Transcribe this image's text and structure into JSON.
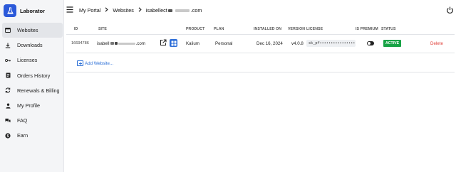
{
  "brand": {
    "name": "Laborator"
  },
  "sidebar": {
    "items": [
      {
        "label": "Websites",
        "icon": "browser-icon",
        "active": true
      },
      {
        "label": "Downloads",
        "icon": "download-icon",
        "active": false
      },
      {
        "label": "Licenses",
        "icon": "key-icon",
        "active": false
      },
      {
        "label": "Orders History",
        "icon": "receipt-icon",
        "active": false
      },
      {
        "label": "Renewals & Billing",
        "icon": "renew-icon",
        "active": false
      },
      {
        "label": "My Profile",
        "icon": "user-icon",
        "active": false
      },
      {
        "label": "FAQ",
        "icon": "chat-icon",
        "active": false
      },
      {
        "label": "Earn",
        "icon": "coin-icon",
        "active": false
      }
    ]
  },
  "breadcrumb": {
    "items": [
      "My Portal",
      "Websites",
      "isabellect"
    ],
    "last_suffix": ".com"
  },
  "table": {
    "headers": {
      "id": "ID",
      "site": "SITE",
      "product": "PRODUCT",
      "plan": "PLAN",
      "installed_on": "INSTALLED ON",
      "version": "VERSION",
      "license": "LICENSE",
      "is_premium": "IS PREMIUM",
      "status": "STATUS"
    },
    "rows": [
      {
        "id": "16694786",
        "site_prefix": "isabell",
        "site_suffix": ".com",
        "product": "Kalium",
        "plan": "Personal",
        "installed_on": "Dec 16, 2024",
        "version": "v4.0.8",
        "license": "sk_pf••••••••••••••••••",
        "status": "ACTIVE",
        "delete_label": "Delete"
      }
    ],
    "add_label": "Add Website..."
  },
  "colors": {
    "accent": "#2b59d9",
    "link": "#2b6fd6",
    "active_badge": "#18a346",
    "delete": "#e0413b"
  }
}
